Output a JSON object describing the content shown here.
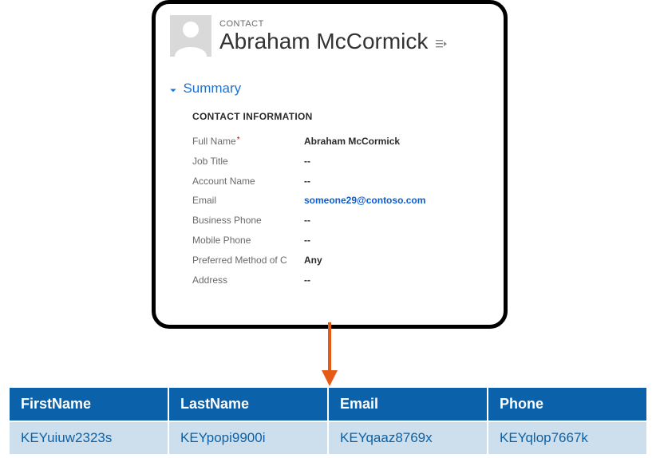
{
  "card": {
    "entity_label": "CONTACT",
    "title": "Abraham McCormick",
    "section": "Summary",
    "subsection": "CONTACT INFORMATION",
    "fields": {
      "full_name": {
        "label": "Full Name",
        "value": "Abraham McCormick",
        "required": true
      },
      "job_title": {
        "label": "Job Title",
        "value": "--"
      },
      "account_name": {
        "label": "Account Name",
        "value": "--"
      },
      "email": {
        "label": "Email",
        "value": "someone29@contoso.com",
        "is_link": true
      },
      "business_phone": {
        "label": "Business Phone",
        "value": "--"
      },
      "mobile_phone": {
        "label": "Mobile Phone",
        "value": "--"
      },
      "preferred_method": {
        "label": "Preferred Method of C",
        "value": "Any"
      },
      "address": {
        "label": "Address",
        "value": "--"
      }
    }
  },
  "table": {
    "headers": [
      "FirstName",
      "LastName",
      "Email",
      "Phone"
    ],
    "row": [
      "KEYuiuw2323s",
      "KEYpopi9900i",
      "KEYqaaz8769x",
      "KEYqlop7667k"
    ]
  },
  "colors": {
    "arrow": "#e65a17",
    "table_header_bg": "#0c62aa",
    "table_row_bg": "#cddfec",
    "link": "#0b5cd6"
  }
}
